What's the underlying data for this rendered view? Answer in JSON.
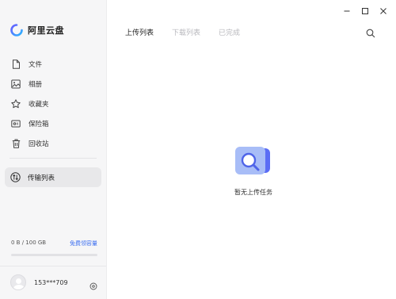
{
  "app": {
    "name": "阿里云盘"
  },
  "sidebar": {
    "items": [
      {
        "label": "文件",
        "icon": "file-icon"
      },
      {
        "label": "相册",
        "icon": "photo-icon"
      },
      {
        "label": "收藏夹",
        "icon": "star-icon"
      },
      {
        "label": "保险箱",
        "icon": "safe-icon"
      },
      {
        "label": "回收站",
        "icon": "trash-icon"
      }
    ],
    "transfer": {
      "label": "传输列表",
      "icon": "transfer-icon"
    },
    "storage": {
      "usage_text": "0 B / 100 GB",
      "link": "免费领容量",
      "used_fraction": 0
    },
    "user": {
      "name": "153***709"
    }
  },
  "main": {
    "tabs": [
      {
        "label": "上传列表",
        "active": true
      },
      {
        "label": "下载列表",
        "active": false
      },
      {
        "label": "已完成",
        "active": false
      }
    ],
    "empty_text": "暂无上传任务"
  },
  "colors": {
    "accent": "#5b7cff",
    "link": "#3a6df0",
    "sidebar_bg": "#f6f6f7"
  }
}
